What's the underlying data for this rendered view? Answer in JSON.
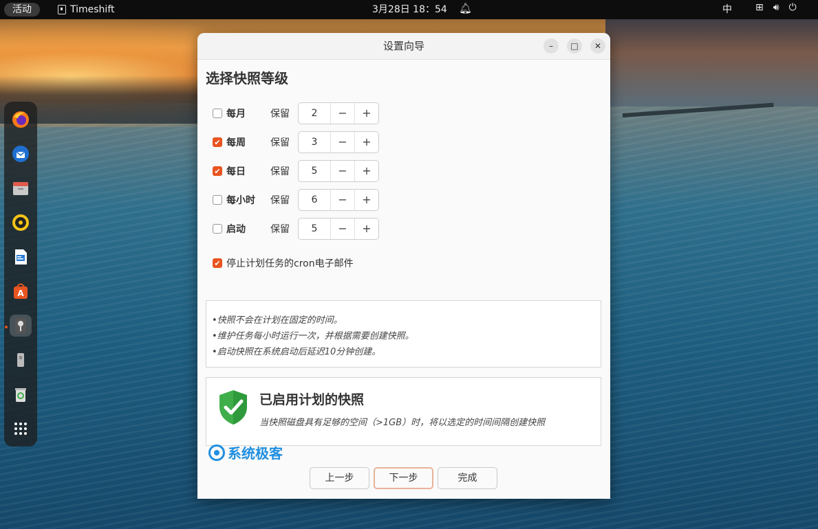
{
  "topbar": {
    "activities": "活动",
    "app_name": "Timeshift",
    "clock": "3月28日 18：54",
    "input_method": "中"
  },
  "window": {
    "title": "设置向导",
    "heading": "选择快照等级",
    "keep_label": "保留",
    "levels": [
      {
        "name": "每月",
        "checked": false,
        "value": "2"
      },
      {
        "name": "每周",
        "checked": true,
        "value": "3"
      },
      {
        "name": "每日",
        "checked": true,
        "value": "5"
      },
      {
        "name": "每小时",
        "checked": false,
        "value": "6"
      },
      {
        "name": "启动",
        "checked": false,
        "value": "5"
      }
    ],
    "cron_label": "停止计划任务的cron电子邮件",
    "cron_checked": true,
    "notes": [
      "•快照不会在计划在固定的时间。",
      "•维护任务每小时运行一次，并根据需要创建快照。",
      "•启动快照在系统启动后延迟10分钟创建。"
    ],
    "status_title": "已启用计划的快照",
    "status_desc": "当快照磁盘具有足够的空间（>1GB）时，将以选定的时间间隔创建快照",
    "watermark": "系统极客",
    "buttons": {
      "prev": "上一步",
      "next": "下一步",
      "finish": "完成"
    }
  },
  "colors": {
    "accent": "#e95420",
    "shield": "#3fae49"
  }
}
